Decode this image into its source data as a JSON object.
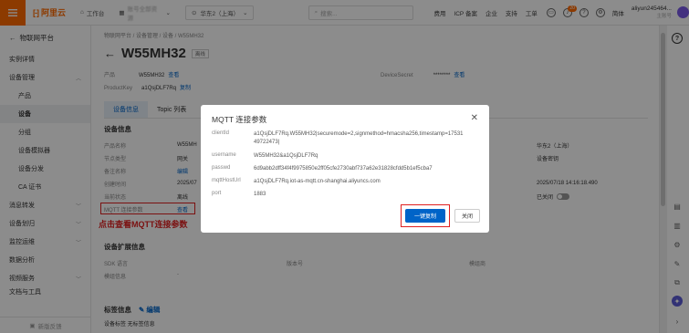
{
  "topbar": {
    "logo_text": "阿里云",
    "workbench": "工作台",
    "org": "账号全部资源",
    "region": "华东2（上海）",
    "search_placeholder": "搜索...",
    "links": [
      "费用",
      "ICP 备案",
      "企业",
      "支持",
      "工单"
    ],
    "notif_count": "20",
    "lang": "简体",
    "user_name": "aliyun245464...",
    "user_sub": "主账号"
  },
  "sidebar": {
    "back": "物联网平台",
    "items": [
      {
        "label": "实例详情"
      },
      {
        "label": "设备管理"
      },
      {
        "label": "产品"
      },
      {
        "label": "设备"
      },
      {
        "label": "分组"
      },
      {
        "label": "设备模拟器"
      },
      {
        "label": "设备分发"
      },
      {
        "label": "CA 证书"
      },
      {
        "label": "消息转发"
      },
      {
        "label": "设备划归"
      },
      {
        "label": "监控运维"
      },
      {
        "label": "数据分析"
      },
      {
        "label": "视频服务"
      },
      {
        "label": "文档与工具"
      }
    ],
    "bottom": "新版反馈"
  },
  "main": {
    "breadcrumb": "物联网平台 / 设备管理 / 设备 / W55MH32",
    "title": "W55MH32",
    "status_tag": "离线",
    "product_label": "产品",
    "product_value": "W55MH32",
    "product_link": "查看",
    "pk_label": "ProductKey",
    "pk_value": "a1QsjDLF7Rq",
    "pk_link": "复制",
    "secret_label": "DeviceSecret",
    "secret_value": "********",
    "secret_link": "查看",
    "tabs": [
      "设备信息",
      "Topic 列表",
      "物"
    ],
    "info_title": "设备信息",
    "info_rows": [
      {
        "label": "产品名称",
        "value": "W55MH"
      },
      {
        "label": "节点类型",
        "value": "网关"
      },
      {
        "label": "备注名称",
        "value": "编辑"
      },
      {
        "label": "创建时间",
        "value": "2025/07"
      },
      {
        "label": "当前状态",
        "value": "离线"
      },
      {
        "label": "MQTT 连接参数",
        "value": "查看"
      }
    ],
    "right_rows": [
      {
        "label": "",
        "value": "华东2（上海）"
      },
      {
        "label": "",
        "value": "设备密钥"
      },
      {
        "label": "",
        "value": ""
      },
      {
        "label": "",
        "value": "2025/07/18 14:16:18.490"
      },
      {
        "label": "日志",
        "value": "已关闭"
      }
    ],
    "annotation": "点击查看MQTT连接参数",
    "ext_title": "设备扩展信息",
    "ext_row1": [
      "SDK 语言",
      "",
      "版本号",
      "",
      "模组商"
    ],
    "ext_row2": [
      "模组信息",
      "-"
    ],
    "tag_title": "标签信息",
    "tag_edit": "编辑",
    "tag_row": "设备标签  无标签信息"
  },
  "modal": {
    "title": "MQTT 连接参数",
    "rows": [
      {
        "key": "clientId",
        "value": "a1QsjDLF7Rq.W55MH32|securemode=2,signmethod=hmacsha256,timestamp=1753149722473|"
      },
      {
        "key": "username",
        "value": "W55MH32&a1QsjDLF7Rq"
      },
      {
        "key": "passwd",
        "value": "6d9abb2dff34f4f9975850e2ff05cfe2730abf737a62e31828cfdd5b1ef5cba7"
      },
      {
        "key": "mqttHostUrl",
        "value": "a1QsjDLF7Rq.iot-as-mqtt.cn-shanghai.aliyuncs.com"
      },
      {
        "key": "port",
        "value": "1883"
      }
    ],
    "copy_button": "一键复制",
    "close_button": "关闭"
  },
  "colors": {
    "accent": "#ff6a00",
    "primary": "#0064c8",
    "highlight": "#e02020"
  }
}
